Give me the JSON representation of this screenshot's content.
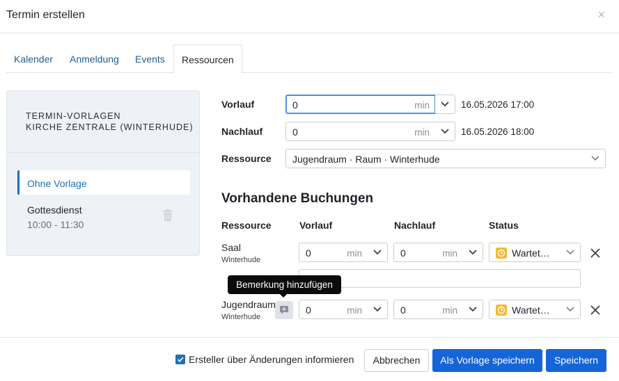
{
  "dialog": {
    "title": "Termin erstellen",
    "close_glyph": "×"
  },
  "tabs": [
    {
      "label": "Kalender",
      "active": false
    },
    {
      "label": "Anmeldung",
      "active": false
    },
    {
      "label": "Events",
      "active": false
    },
    {
      "label": "Ressourcen",
      "active": true
    }
  ],
  "templates": {
    "heading_line1": "TERMIN-VORLAGEN",
    "heading_line2": "KIRCHE ZENTRALE (WINTERHUDE)",
    "items": [
      {
        "name": "Ohne Vorlage",
        "active": true
      },
      {
        "name": "Gottesdienst",
        "time": "10:00 - 11:30",
        "active": false
      }
    ]
  },
  "form": {
    "vorlauf": {
      "label": "Vorlauf",
      "value": "0",
      "unit": "min",
      "computed": "16.05.2026 17:00"
    },
    "nachlauf": {
      "label": "Nachlauf",
      "value": "0",
      "unit": "min",
      "computed": "16.05.2026 18:00"
    },
    "ressource": {
      "label": "Ressource",
      "value": "Jugendraum · Raum · Winterhude"
    }
  },
  "bookings": {
    "title": "Vorhandene Buchungen",
    "columns": {
      "ressource": "Ressource",
      "vorlauf": "Vorlauf",
      "nachlauf": "Nachlauf",
      "status": "Status"
    },
    "rows": [
      {
        "name": "Saal",
        "location": "Winterhude",
        "vorlauf": "0",
        "nachlauf": "0",
        "unit": "min",
        "status": "Wartet…"
      },
      {
        "name": "Jugendraum",
        "location": "Winterhude",
        "vorlauf": "0",
        "nachlauf": "0",
        "unit": "min",
        "status": "Wartet…"
      }
    ],
    "tooltip": "Bemerkung hinzufügen"
  },
  "footer": {
    "notify_label": "Ersteller über Änderungen informieren",
    "notify_checked": true,
    "cancel": "Abbrechen",
    "save_template": "Als Vorlage speichern",
    "save": "Speichern"
  },
  "colors": {
    "accent": "#1565d8",
    "link": "#1f5f97",
    "status_pending": "#f5b82e"
  },
  "icons": [
    "close-icon",
    "trash-icon",
    "chevron-down-icon",
    "clock-icon",
    "x-icon",
    "comment-add-icon",
    "check-icon"
  ]
}
